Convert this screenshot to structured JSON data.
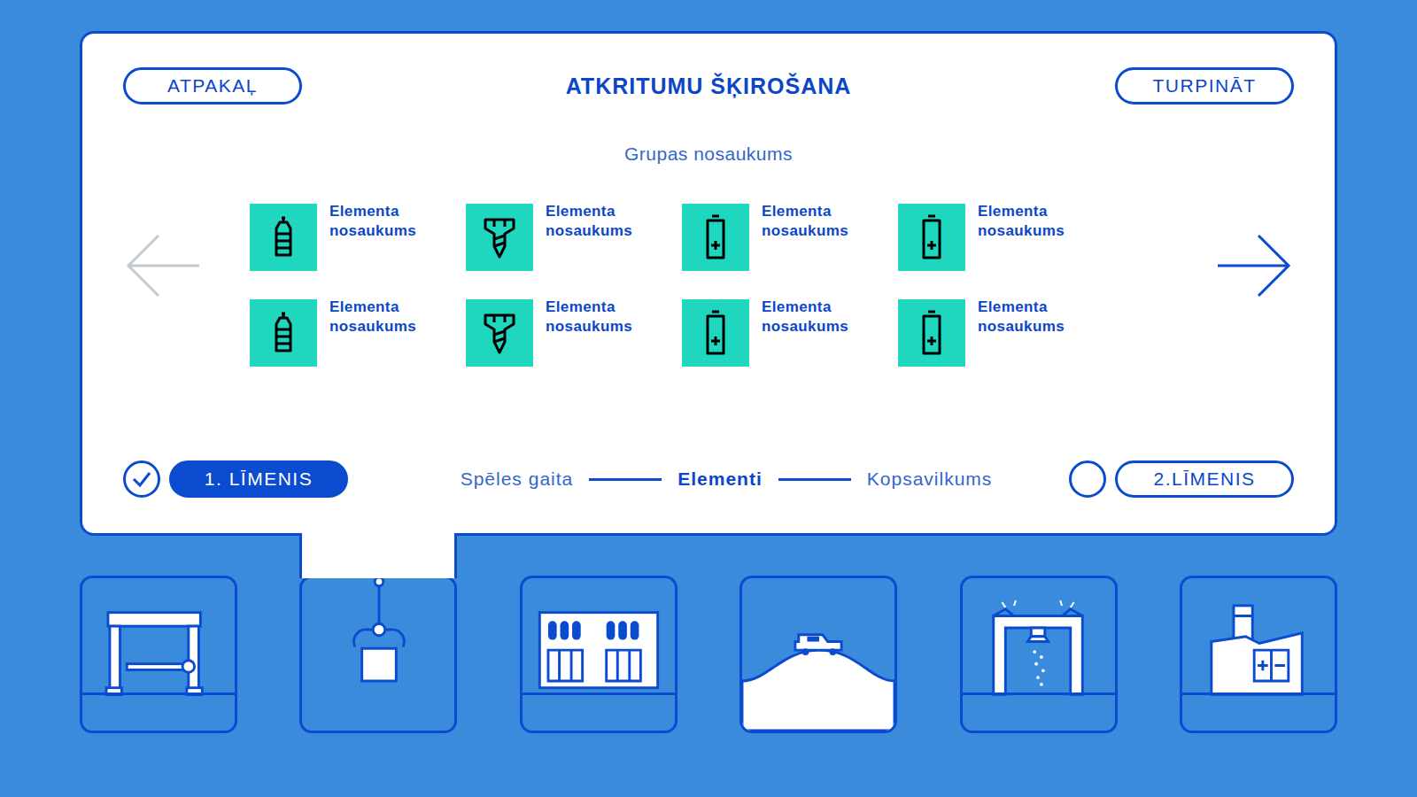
{
  "header": {
    "back": "ATPAKAĻ",
    "title": "ATKRITUMU ŠĶIROŠANA",
    "continue": "TURPINĀT"
  },
  "group": "Grupas nosaukums",
  "nav": {
    "prev": {
      "disabled": true
    },
    "next": {
      "disabled": false
    }
  },
  "elements": [
    {
      "name": "Elementa nosaukums"
    },
    {
      "name": "Elementa nosaukums"
    },
    {
      "name": "Elementa nosaukums"
    },
    {
      "name": "Elementa nosaukums"
    },
    {
      "name": "Elementa nosaukums"
    },
    {
      "name": "Elementa nosaukums"
    },
    {
      "name": "Elementa nosaukums"
    },
    {
      "name": "Elementa nosaukums"
    }
  ],
  "levels": [
    {
      "label": "1. LĪMENIS",
      "done": true,
      "selected": true
    },
    {
      "label": "2.LĪMENIS",
      "done": false,
      "selected": false
    }
  ],
  "steps": [
    {
      "label": "Spēles gaita",
      "selected": false
    },
    {
      "label": "Elementi",
      "selected": true
    },
    {
      "label": "Kopsavilkums",
      "selected": false
    }
  ],
  "stations": [
    {
      "selected": false
    },
    {
      "selected": true
    },
    {
      "selected": false
    },
    {
      "selected": false
    },
    {
      "selected": false
    },
    {
      "selected": false
    }
  ]
}
